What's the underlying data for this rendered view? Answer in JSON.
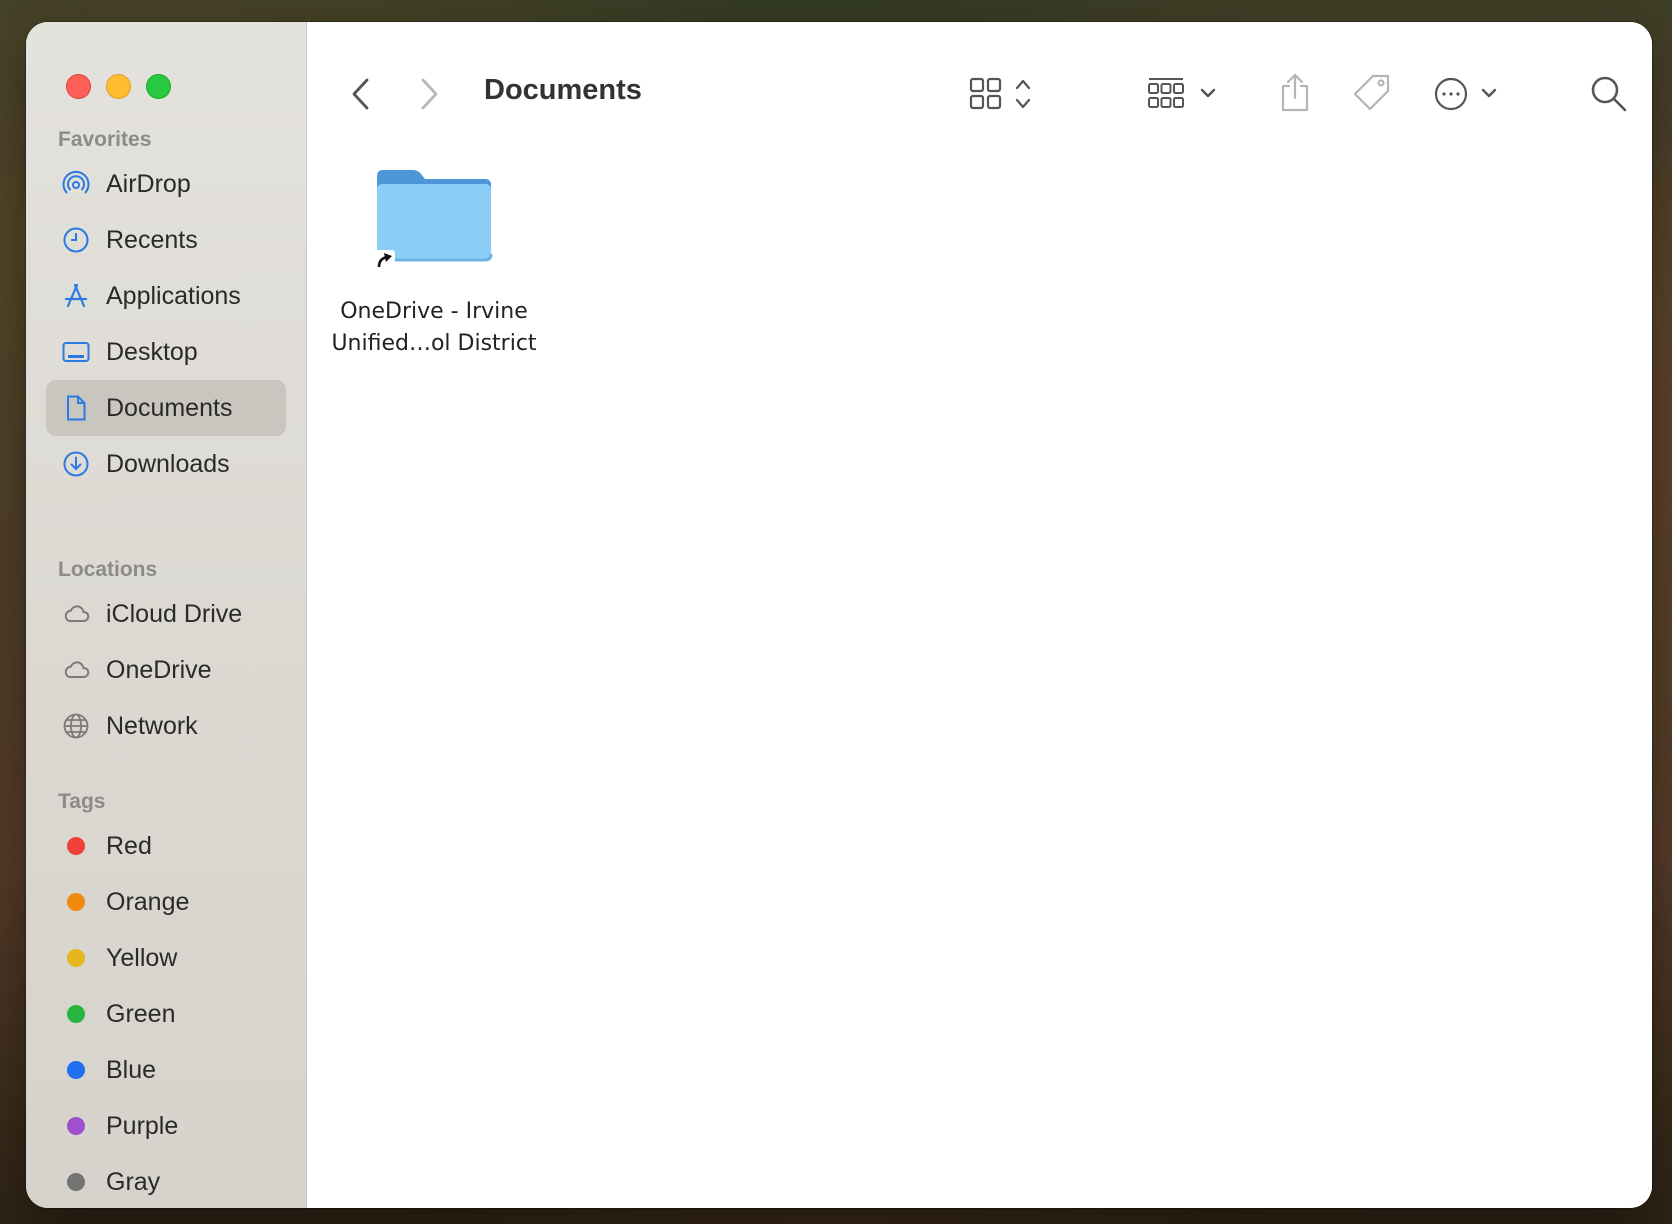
{
  "window": {
    "title": "Documents"
  },
  "sidebar": {
    "favorites_title": "Favorites",
    "favorites": [
      {
        "label": "AirDrop",
        "icon": "airdrop-icon"
      },
      {
        "label": "Recents",
        "icon": "clock-icon"
      },
      {
        "label": "Applications",
        "icon": "applications-icon"
      },
      {
        "label": "Desktop",
        "icon": "desktop-icon"
      },
      {
        "label": "Documents",
        "icon": "document-icon",
        "selected": true
      },
      {
        "label": "Downloads",
        "icon": "download-icon"
      }
    ],
    "locations_title": "Locations",
    "locations": [
      {
        "label": "iCloud Drive",
        "icon": "cloud-icon"
      },
      {
        "label": "OneDrive",
        "icon": "cloud-icon"
      },
      {
        "label": "Network",
        "icon": "globe-icon"
      }
    ],
    "tags_title": "Tags",
    "tags": [
      {
        "label": "Red",
        "color": "#f0403a"
      },
      {
        "label": "Orange",
        "color": "#f08a0f"
      },
      {
        "label": "Yellow",
        "color": "#e6b51b"
      },
      {
        "label": "Green",
        "color": "#29b43f"
      },
      {
        "label": "Blue",
        "color": "#1f6ff0"
      },
      {
        "label": "Purple",
        "color": "#a04fce"
      },
      {
        "label": "Gray",
        "color": "#737373"
      }
    ]
  },
  "toolbar": {
    "back_icon": "chevron-left-icon",
    "forward_icon": "chevron-right-icon",
    "view_icon": "icon-grid-icon",
    "group_icon": "group-grid-icon",
    "share_icon": "share-icon",
    "tag_icon": "tag-icon",
    "more_icon": "ellipsis-circle-icon",
    "search_icon": "search-icon"
  },
  "files": [
    {
      "name": "OneDrive - Irvine\nUnified…ol District",
      "type": "folder-alias",
      "color": "#76c0f2"
    }
  ]
}
